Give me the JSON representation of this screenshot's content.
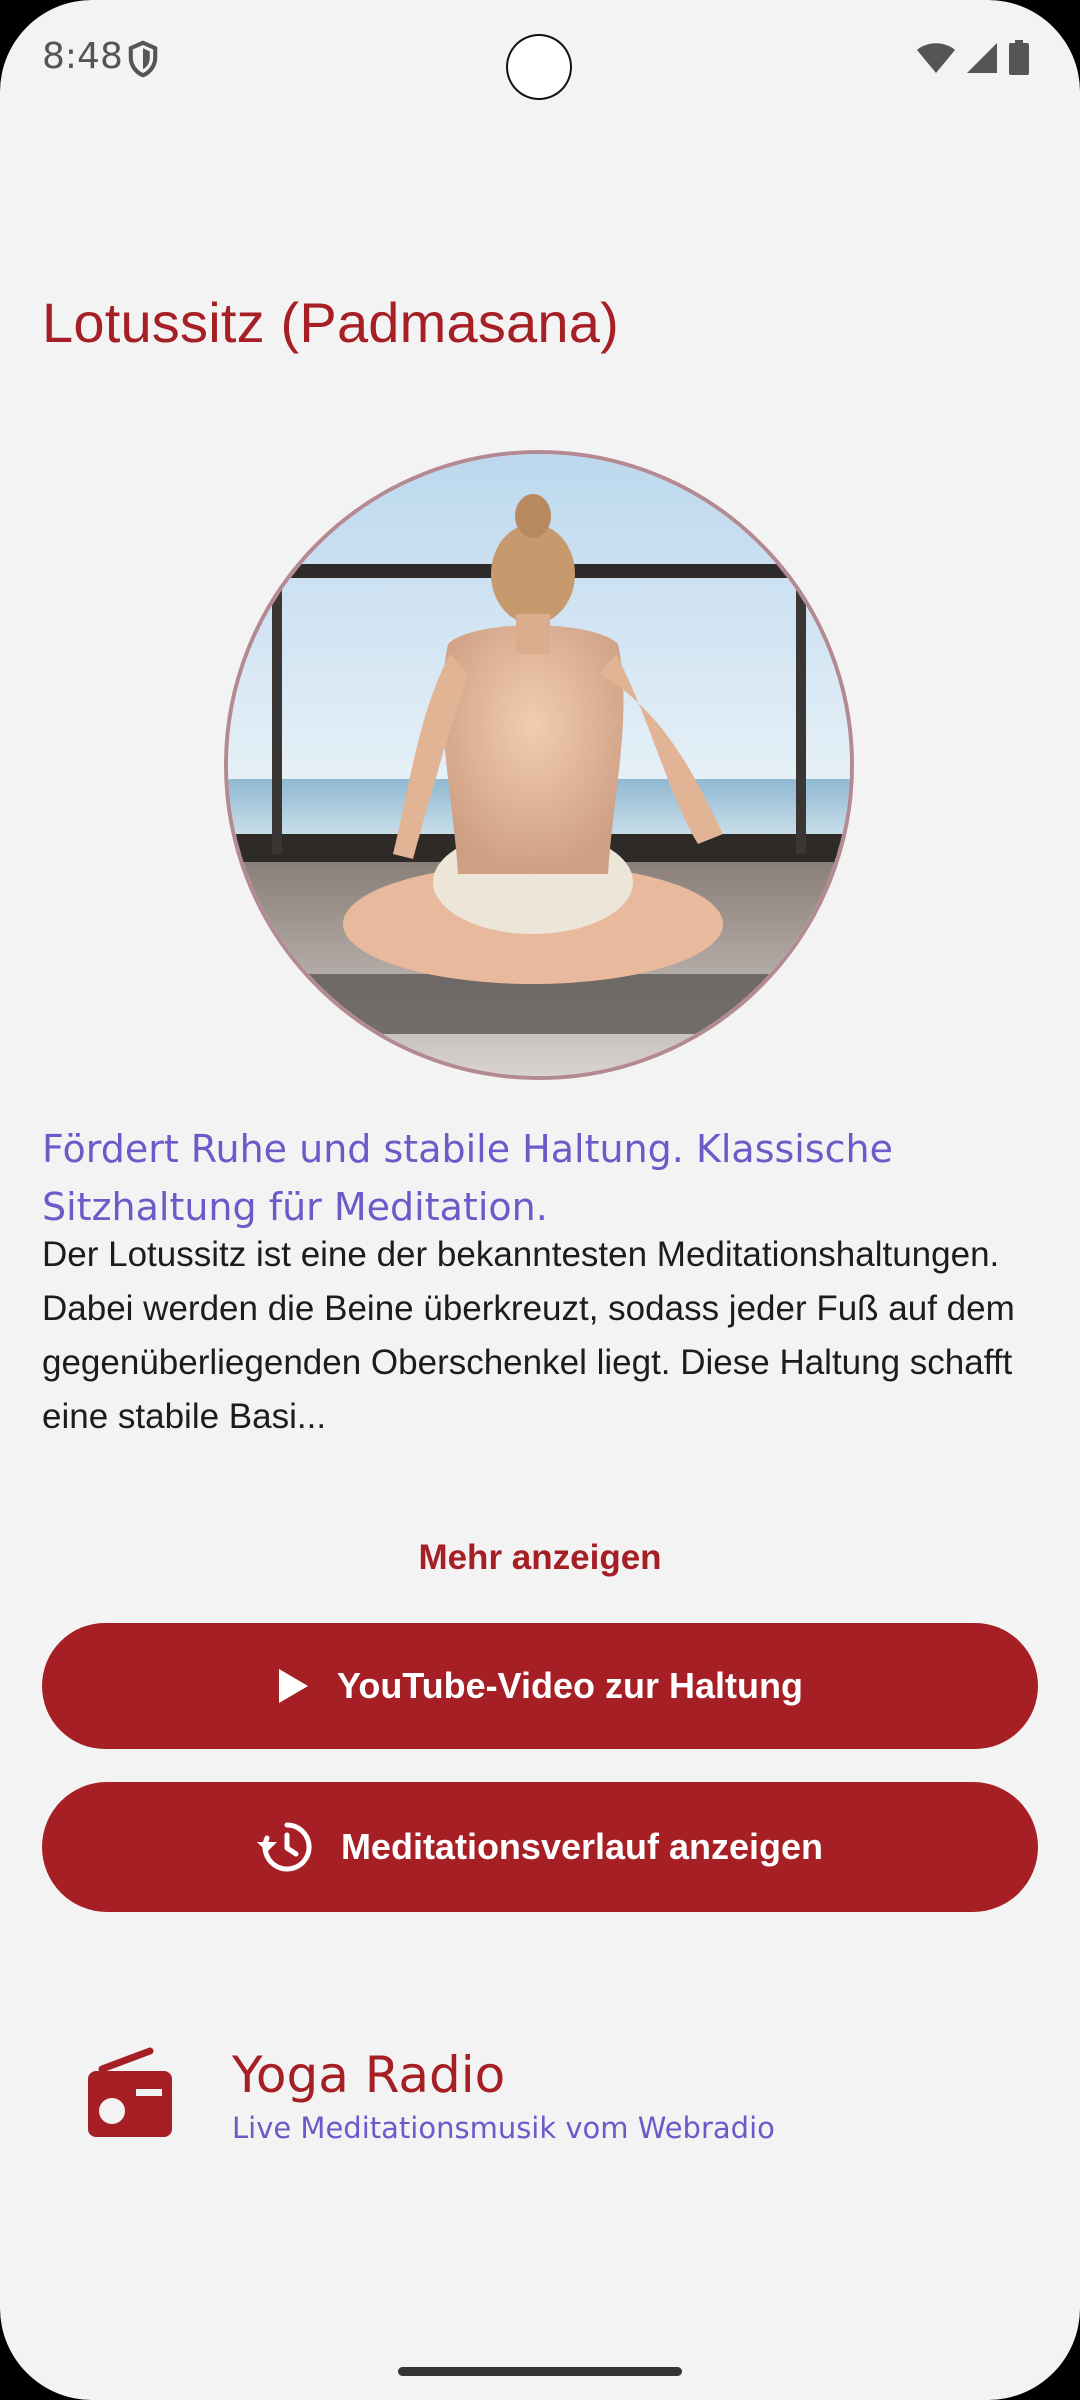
{
  "status_bar": {
    "time": "8:48"
  },
  "page": {
    "title": "Lotussitz (Padmasana)",
    "subtitle": "Fördert Ruhe und stabile Haltung. Klassische Sitzhaltung für Meditation.",
    "description": "Der Lotussitz ist eine der bekanntesten Meditationshaltungen. Dabei werden die Beine überkreuzt, sodass jeder Fuß auf dem gegenüberliegenden Oberschenkel liegt. Diese Haltung schafft eine stabile Basi...",
    "more_label": "Mehr anzeigen"
  },
  "buttons": {
    "youtube_label": "YouTube-Video zur Haltung",
    "history_label": "Meditationsverlauf anzeigen"
  },
  "radio": {
    "title": "Yoga Radio",
    "subtitle": "Live Meditationsmusik vom Webradio"
  },
  "icons": {
    "status": [
      "shield-icon",
      "wifi-icon",
      "cellular-signal-icon",
      "battery-icon"
    ],
    "youtube_button": "play-icon",
    "history_button": "history-icon",
    "radio": "radio-icon"
  },
  "colors": {
    "accent": "#a51f25",
    "secondary": "#6a5bc9",
    "background": "#f4f3f3"
  }
}
